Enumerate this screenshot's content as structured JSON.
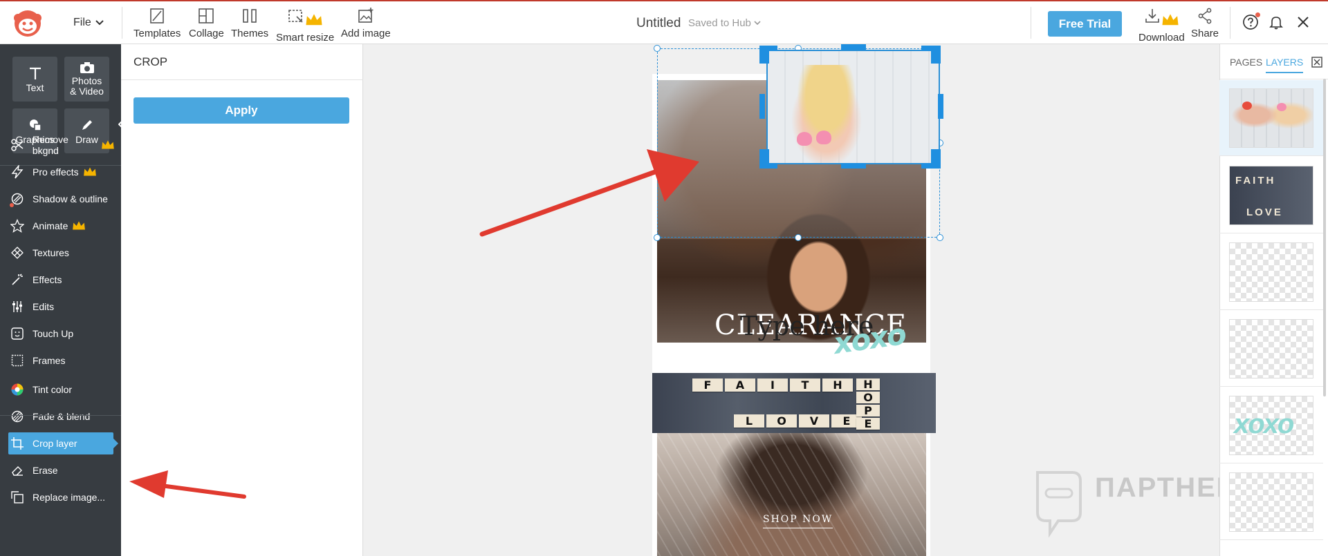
{
  "app": {
    "logo_icon": "picmonkey-monkey-logo",
    "brand_color": "#e8604c",
    "accent_color": "#4aa7df",
    "file_menu": "File",
    "doc_title": "Untitled",
    "doc_status": "Saved to Hub"
  },
  "toolbar": {
    "templates": "Templates",
    "collage": "Collage",
    "themes": "Themes",
    "smart_resize": "Smart resize",
    "add_image": "Add image",
    "free_trial": "Free Trial",
    "download": "Download",
    "share": "Share"
  },
  "left_rail": {
    "tiles": [
      {
        "label": "Text",
        "icon": "text-icon"
      },
      {
        "label": "Photos & Video",
        "icon": "camera-icon"
      },
      {
        "label": "Graphics",
        "icon": "graphics-icon"
      },
      {
        "label": "Draw",
        "icon": "pencil-icon"
      }
    ],
    "items": [
      {
        "label": "Remove bkgnd",
        "icon": "scissors-icon",
        "premium": true
      },
      {
        "label": "Pro effects",
        "icon": "lightning-icon",
        "premium": true
      },
      {
        "label": "Shadow & outline",
        "icon": "shadow-icon",
        "premium": false
      },
      {
        "label": "Animate",
        "icon": "star-icon",
        "premium": true
      },
      {
        "label": "Textures",
        "icon": "texture-icon",
        "premium": false
      },
      {
        "label": "Effects",
        "icon": "wand-icon",
        "premium": false
      },
      {
        "label": "Edits",
        "icon": "sliders-icon",
        "premium": false
      },
      {
        "label": "Touch Up",
        "icon": "face-icon",
        "premium": false
      },
      {
        "label": "Frames",
        "icon": "frame-icon",
        "premium": false
      },
      {
        "label": "Tint color",
        "icon": "color-wheel-icon",
        "premium": false
      },
      {
        "label": "Fade & blend",
        "icon": "blend-icon",
        "premium": false
      },
      {
        "label": "Crop layer",
        "icon": "crop-icon",
        "premium": false,
        "active": true
      },
      {
        "label": "Erase",
        "icon": "eraser-icon",
        "premium": false
      },
      {
        "label": "Replace image...",
        "icon": "replace-icon",
        "premium": false
      }
    ]
  },
  "crop_panel": {
    "title": "CROP",
    "apply": "Apply"
  },
  "canvas": {
    "texts": {
      "clearance": "CLEARANCE",
      "type_here": "Type here",
      "xoxo": "xoxo",
      "shop_now": "SHOP NOW"
    },
    "faith_tiles": [
      "F",
      "A",
      "I",
      "T",
      "H"
    ],
    "love_tiles": [
      "L",
      "O",
      "V",
      "E"
    ],
    "hope_tiles": [
      "H",
      "O",
      "P",
      "E"
    ]
  },
  "right_panel": {
    "tabs": {
      "pages": "PAGES",
      "layers": "LAYERS"
    },
    "layers": [
      {
        "name": "photo-couple-layer",
        "selected": true
      },
      {
        "name": "faith-hope-love-layer",
        "selected": false
      },
      {
        "name": "blank-layer",
        "selected": false
      },
      {
        "name": "blank-layer",
        "selected": false
      },
      {
        "name": "xoxo-layer",
        "selected": false
      },
      {
        "name": "blank-layer",
        "selected": false
      }
    ],
    "thumb_texts": {
      "faith": "FAITH",
      "love": "LOVE",
      "xoxo": "xoxo"
    }
  },
  "watermark": {
    "text": "ПАРТНЕРКИН"
  }
}
